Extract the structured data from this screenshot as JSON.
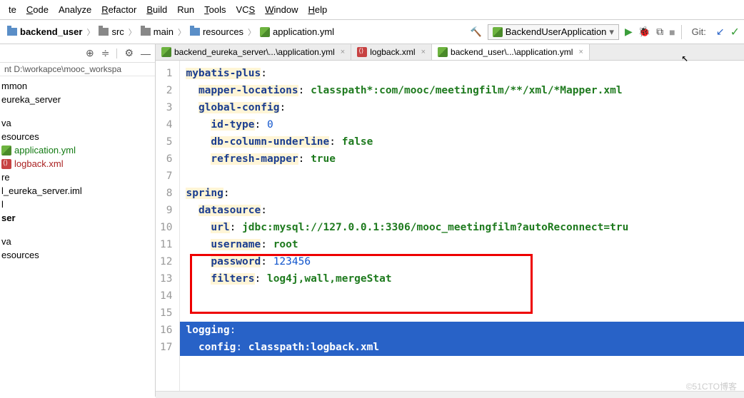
{
  "menu": [
    "te",
    "Code",
    "Analyze",
    "Refactor",
    "Build",
    "Run",
    "Tools",
    "VCS",
    "Window",
    "Help"
  ],
  "menu_underline": [
    "",
    "C",
    "",
    "R",
    "B",
    "",
    "T",
    "S",
    "W",
    "H"
  ],
  "breadcrumbs": [
    {
      "icon": "folder-blue",
      "label": "backend_user"
    },
    {
      "icon": "folder",
      "label": "src"
    },
    {
      "icon": "folder",
      "label": "main"
    },
    {
      "icon": "folder-blue",
      "label": "resources"
    },
    {
      "icon": "yml",
      "label": "application.yml"
    }
  ],
  "runconfig": "BackendUserApplication",
  "git_label": "Git:",
  "sidebar_path": "nt  D:\\workapce\\mooc_workspa",
  "tree_items": [
    {
      "label": "mmon",
      "cls": ""
    },
    {
      "label": "eureka_server",
      "cls": ""
    },
    {
      "label": "",
      "cls": "",
      "gap": true
    },
    {
      "label": "va",
      "cls": ""
    },
    {
      "label": "esources",
      "cls": ""
    },
    {
      "label": "application.yml",
      "cls": "green",
      "icon": "yml"
    },
    {
      "label": "logback.xml",
      "cls": "red",
      "icon": "xml"
    },
    {
      "label": "re",
      "cls": ""
    },
    {
      "label": "l_eureka_server.iml",
      "cls": ""
    },
    {
      "label": "l",
      "cls": ""
    },
    {
      "label": "ser",
      "cls": "bold"
    },
    {
      "label": "",
      "cls": "",
      "gap": true
    },
    {
      "label": "va",
      "cls": ""
    },
    {
      "label": "esources",
      "cls": ""
    }
  ],
  "tabs": [
    {
      "icon": "yml",
      "label": "backend_eureka_server\\...\\application.yml",
      "active": false
    },
    {
      "icon": "xml",
      "label": "logback.xml",
      "active": false
    },
    {
      "icon": "yml",
      "label": "backend_user\\...\\application.yml",
      "active": true
    }
  ],
  "code": {
    "lines": [
      {
        "n": 1,
        "html": "<span class='key'>mybatis-plus</span>:"
      },
      {
        "n": 2,
        "html": "  <span class='key'>mapper-locations</span>: <span class='val'>classpath*:com/mooc/meetingfilm/**/xml/*Mapper.xml</span>"
      },
      {
        "n": 3,
        "html": "  <span class='key'>global-config</span>:"
      },
      {
        "n": 4,
        "html": "    <span class='key'>id-type</span>: <span class='num'>0</span>"
      },
      {
        "n": 5,
        "html": "    <span class='key'>db-column-underline</span>: <span class='val'>false</span>"
      },
      {
        "n": 6,
        "html": "    <span class='key'>refresh-mapper</span>: <span class='val'>true</span>"
      },
      {
        "n": 7,
        "html": ""
      },
      {
        "n": 8,
        "html": "<span class='key'>spring</span>:"
      },
      {
        "n": 9,
        "html": "  <span class='key'>datasource</span>:"
      },
      {
        "n": 10,
        "html": "    <span class='key'>url</span>: <span class='val'>jdbc:mysql://127.0.0.1:3306/mooc_meetingfilm?autoReconnect=tru</span>"
      },
      {
        "n": 11,
        "html": "    <span class='key'>username</span>: <span class='val'>root</span>"
      },
      {
        "n": 12,
        "html": "    <span class='key'>password</span>: <span class='num'>123456</span>"
      },
      {
        "n": 13,
        "html": "    <span class='key'>filters</span>: <span class='val'>log4j,wall,mergeStat</span>"
      },
      {
        "n": 14,
        "html": ""
      },
      {
        "n": 15,
        "html": ""
      },
      {
        "n": 16,
        "html": "<span class='key'>logging</span>:",
        "sel": true
      },
      {
        "n": 17,
        "html": "  <span class='key'>config</span>: <span class='val'>classpath:logback.xml</span>",
        "sel": true
      }
    ]
  },
  "watermark": "©51CTO博客"
}
